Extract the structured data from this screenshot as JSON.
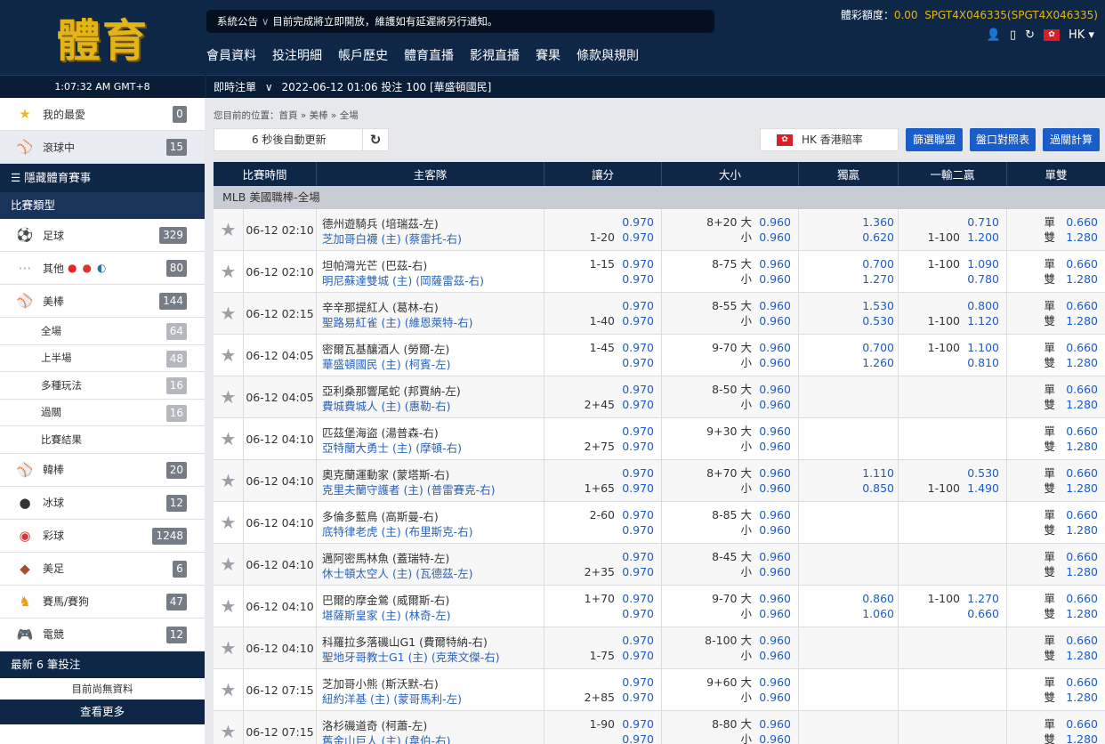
{
  "header": {
    "logo_text": "體育",
    "clock": "1:07:32 AM GMT+8",
    "notice_label": "系統公告",
    "notice_text": "目前完成將立即開放，維護如有延遲將另行通知。",
    "nav": [
      "會員資料",
      "投注明細",
      "帳戶歷史",
      "體育直播",
      "影視直播",
      "賽果",
      "條款與規則"
    ],
    "credit_label": "體彩額度：",
    "credit_value": "0.00",
    "account": "SPGT4X046335(SPGT4X046335)",
    "region": "HK",
    "live_bet_label": "即時注單",
    "last_bet": "2022-06-12 01:06 投注 100 [華盛頓國民]"
  },
  "sidebar": {
    "top_items": [
      {
        "label": "我的最愛",
        "count": "0",
        "icon": "star-icon"
      },
      {
        "label": "滾球中",
        "count": "15",
        "icon": "live-ball-icon"
      }
    ],
    "hide_label": "隱藏體育賽事",
    "type_label": "比賽類型",
    "sports": [
      {
        "label": "足球",
        "count": "329",
        "icon": "soccer-icon"
      },
      {
        "label": "其他",
        "count": "80",
        "icon": "other-sports-icon"
      },
      {
        "label": "美棒",
        "count": "144",
        "icon": "baseball-icon"
      }
    ],
    "sub_items": [
      {
        "label": "全場",
        "count": "64"
      },
      {
        "label": "上半場",
        "count": "48"
      },
      {
        "label": "多種玩法",
        "count": "16"
      },
      {
        "label": "過關",
        "count": "16"
      },
      {
        "label": "比賽結果",
        "count": ""
      }
    ],
    "sports2": [
      {
        "label": "韓棒",
        "count": "20",
        "icon": "baseball-icon"
      },
      {
        "label": "冰球",
        "count": "12",
        "icon": "hockey-puck-icon"
      },
      {
        "label": "彩球",
        "count": "1248",
        "icon": "lottery-ball-icon"
      },
      {
        "label": "美足",
        "count": "6",
        "icon": "football-icon"
      },
      {
        "label": "賽馬/賽狗",
        "count": "47",
        "icon": "horse-icon"
      },
      {
        "label": "電競",
        "count": "12",
        "icon": "gamepad-icon"
      }
    ],
    "recent_label": "最新 6 筆投注",
    "no_data": "目前尚無資料",
    "more": "查看更多"
  },
  "content": {
    "breadcrumb": "您目前的位置：首頁 » 美棒 » 全場",
    "refresh_text": "6 秒後自動更新",
    "odds_type": "HK 香港賠率",
    "buttons": [
      "篩選聯盟",
      "盤口對照表",
      "過關計算"
    ],
    "columns": [
      "比賽時間",
      "主客隊",
      "讓分",
      "大小",
      "獨贏",
      "一輸二贏",
      "單雙"
    ],
    "league": "MLB 美國職棒-全場",
    "ou_over": "大",
    "ou_under": "小",
    "odd_label": "單",
    "even_label": "雙"
  },
  "matches": [
    {
      "time": "06-12 02:10",
      "away": "德州遊騎兵 (培瑞茲-左)",
      "home": "芝加哥白襪 (主) (蔡雷托-右)",
      "hdp1_line": "",
      "hdp1_odd": "0.970",
      "hdp2_line": "1-20",
      "hdp2_odd": "0.970",
      "ou_line": "8+20",
      "ou_o": "0.960",
      "ou_u": "0.960",
      "ml1": "1.360",
      "ml2": "0.620",
      "t1_line": "",
      "t1": "0.710",
      "t2_line": "1-100",
      "t2": "1.200",
      "odd": "0.660",
      "even": "1.280"
    },
    {
      "time": "06-12 02:10",
      "away": "坦帕灣光芒 (巴茲-右)",
      "home": "明尼蘇達雙城 (主) (岡薩雷茲-右)",
      "hdp1_line": "1-15",
      "hdp1_odd": "0.970",
      "hdp2_line": "",
      "hdp2_odd": "0.970",
      "ou_line": "8-75",
      "ou_o": "0.960",
      "ou_u": "0.960",
      "ml1": "0.700",
      "ml2": "1.270",
      "t1_line": "1-100",
      "t1": "1.090",
      "t2_line": "",
      "t2": "0.780",
      "odd": "0.660",
      "even": "1.280"
    },
    {
      "time": "06-12 02:15",
      "away": "辛辛那提紅人 (葛林-右)",
      "home": "聖路易紅雀 (主) (維恩萊特-右)",
      "hdp1_line": "",
      "hdp1_odd": "0.970",
      "hdp2_line": "1-40",
      "hdp2_odd": "0.970",
      "ou_line": "8-55",
      "ou_o": "0.960",
      "ou_u": "0.960",
      "ml1": "1.530",
      "ml2": "0.530",
      "t1_line": "",
      "t1": "0.800",
      "t2_line": "1-100",
      "t2": "1.120",
      "odd": "0.660",
      "even": "1.280"
    },
    {
      "time": "06-12 04:05",
      "away": "密爾瓦基釀酒人 (勞爾-左)",
      "home": "華盛頓國民 (主) (柯賓-左)",
      "hdp1_line": "1-45",
      "hdp1_odd": "0.970",
      "hdp2_line": "",
      "hdp2_odd": "0.970",
      "ou_line": "9-70",
      "ou_o": "0.960",
      "ou_u": "0.960",
      "ml1": "0.700",
      "ml2": "1.260",
      "t1_line": "1-100",
      "t1": "1.100",
      "t2_line": "",
      "t2": "0.810",
      "odd": "0.660",
      "even": "1.280"
    },
    {
      "time": "06-12 04:05",
      "away": "亞利桑那響尾蛇 (邦賈納-左)",
      "home": "費城費城人 (主) (惠勒-右)",
      "hdp1_line": "",
      "hdp1_odd": "0.970",
      "hdp2_line": "2+45",
      "hdp2_odd": "0.970",
      "ou_line": "8-50",
      "ou_o": "0.960",
      "ou_u": "0.960",
      "ml1": "",
      "ml2": "",
      "t1_line": "",
      "t1": "",
      "t2_line": "",
      "t2": "",
      "odd": "0.660",
      "even": "1.280"
    },
    {
      "time": "06-12 04:10",
      "away": "匹茲堡海盜 (湯普森-右)",
      "home": "亞特蘭大勇士 (主) (摩頓-右)",
      "hdp1_line": "",
      "hdp1_odd": "0.970",
      "hdp2_line": "2+75",
      "hdp2_odd": "0.970",
      "ou_line": "9+30",
      "ou_o": "0.960",
      "ou_u": "0.960",
      "ml1": "",
      "ml2": "",
      "t1_line": "",
      "t1": "",
      "t2_line": "",
      "t2": "",
      "odd": "0.660",
      "even": "1.280"
    },
    {
      "time": "06-12 04:10",
      "away": "奧克蘭運動家 (蒙塔斯-右)",
      "home": "克里夫蘭守護者 (主) (普雷賽克-右)",
      "hdp1_line": "",
      "hdp1_odd": "0.970",
      "hdp2_line": "1+65",
      "hdp2_odd": "0.970",
      "ou_line": "8+70",
      "ou_o": "0.960",
      "ou_u": "0.960",
      "ml1": "1.110",
      "ml2": "0.850",
      "t1_line": "",
      "t1": "0.530",
      "t2_line": "1-100",
      "t2": "1.490",
      "odd": "0.660",
      "even": "1.280"
    },
    {
      "time": "06-12 04:10",
      "away": "多倫多藍鳥 (高斯曼-右)",
      "home": "底特律老虎 (主) (布里斯克-右)",
      "hdp1_line": "2-60",
      "hdp1_odd": "0.970",
      "hdp2_line": "",
      "hdp2_odd": "0.970",
      "ou_line": "8-85",
      "ou_o": "0.960",
      "ou_u": "0.960",
      "ml1": "",
      "ml2": "",
      "t1_line": "",
      "t1": "",
      "t2_line": "",
      "t2": "",
      "odd": "0.660",
      "even": "1.280"
    },
    {
      "time": "06-12 04:10",
      "away": "邁阿密馬林魚 (蓋瑞特-左)",
      "home": "休士頓太空人 (主) (瓦德茲-左)",
      "hdp1_line": "",
      "hdp1_odd": "0.970",
      "hdp2_line": "2+35",
      "hdp2_odd": "0.970",
      "ou_line": "8-45",
      "ou_o": "0.960",
      "ou_u": "0.960",
      "ml1": "",
      "ml2": "",
      "t1_line": "",
      "t1": "",
      "t2_line": "",
      "t2": "",
      "odd": "0.660",
      "even": "1.280"
    },
    {
      "time": "06-12 04:10",
      "away": "巴爾的摩金鶯 (威爾斯-右)",
      "home": "堪薩斯皇家 (主) (林奇-左)",
      "hdp1_line": "1+70",
      "hdp1_odd": "0.970",
      "hdp2_line": "",
      "hdp2_odd": "0.970",
      "ou_line": "9-70",
      "ou_o": "0.960",
      "ou_u": "0.960",
      "ml1": "0.860",
      "ml2": "1.060",
      "t1_line": "1-100",
      "t1": "1.270",
      "t2_line": "",
      "t2": "0.660",
      "odd": "0.660",
      "even": "1.280"
    },
    {
      "time": "06-12 04:10",
      "away": "科羅拉多落磯山G1 (費爾特納-右)",
      "home": "聖地牙哥教士G1 (主) (克萊文傑-右)",
      "hdp1_line": "",
      "hdp1_odd": "0.970",
      "hdp2_line": "1-75",
      "hdp2_odd": "0.970",
      "ou_line": "8-100",
      "ou_o": "0.960",
      "ou_u": "0.960",
      "ml1": "",
      "ml2": "",
      "t1_line": "",
      "t1": "",
      "t2_line": "",
      "t2": "",
      "odd": "0.660",
      "even": "1.280"
    },
    {
      "time": "06-12 07:15",
      "away": "芝加哥小熊 (斯沃默-右)",
      "home": "紐約洋基 (主) (蒙哥馬利-左)",
      "hdp1_line": "",
      "hdp1_odd": "0.970",
      "hdp2_line": "2+85",
      "hdp2_odd": "0.970",
      "ou_line": "9+60",
      "ou_o": "0.960",
      "ou_u": "0.960",
      "ml1": "",
      "ml2": "",
      "t1_line": "",
      "t1": "",
      "t2_line": "",
      "t2": "",
      "odd": "0.660",
      "even": "1.280"
    },
    {
      "time": "06-12 07:15",
      "away": "洛杉磯道奇 (柯蕭-左)",
      "home": "舊金山巨人 (主) (韋伯-右)",
      "hdp1_line": "1-90",
      "hdp1_odd": "0.970",
      "hdp2_line": "",
      "hdp2_odd": "0.970",
      "ou_line": "8-80",
      "ou_o": "0.960",
      "ou_u": "0.960",
      "ml1": "",
      "ml2": "",
      "t1_line": "",
      "t1": "",
      "t2_line": "",
      "t2": "",
      "odd": "0.660",
      "even": "1.280"
    }
  ]
}
